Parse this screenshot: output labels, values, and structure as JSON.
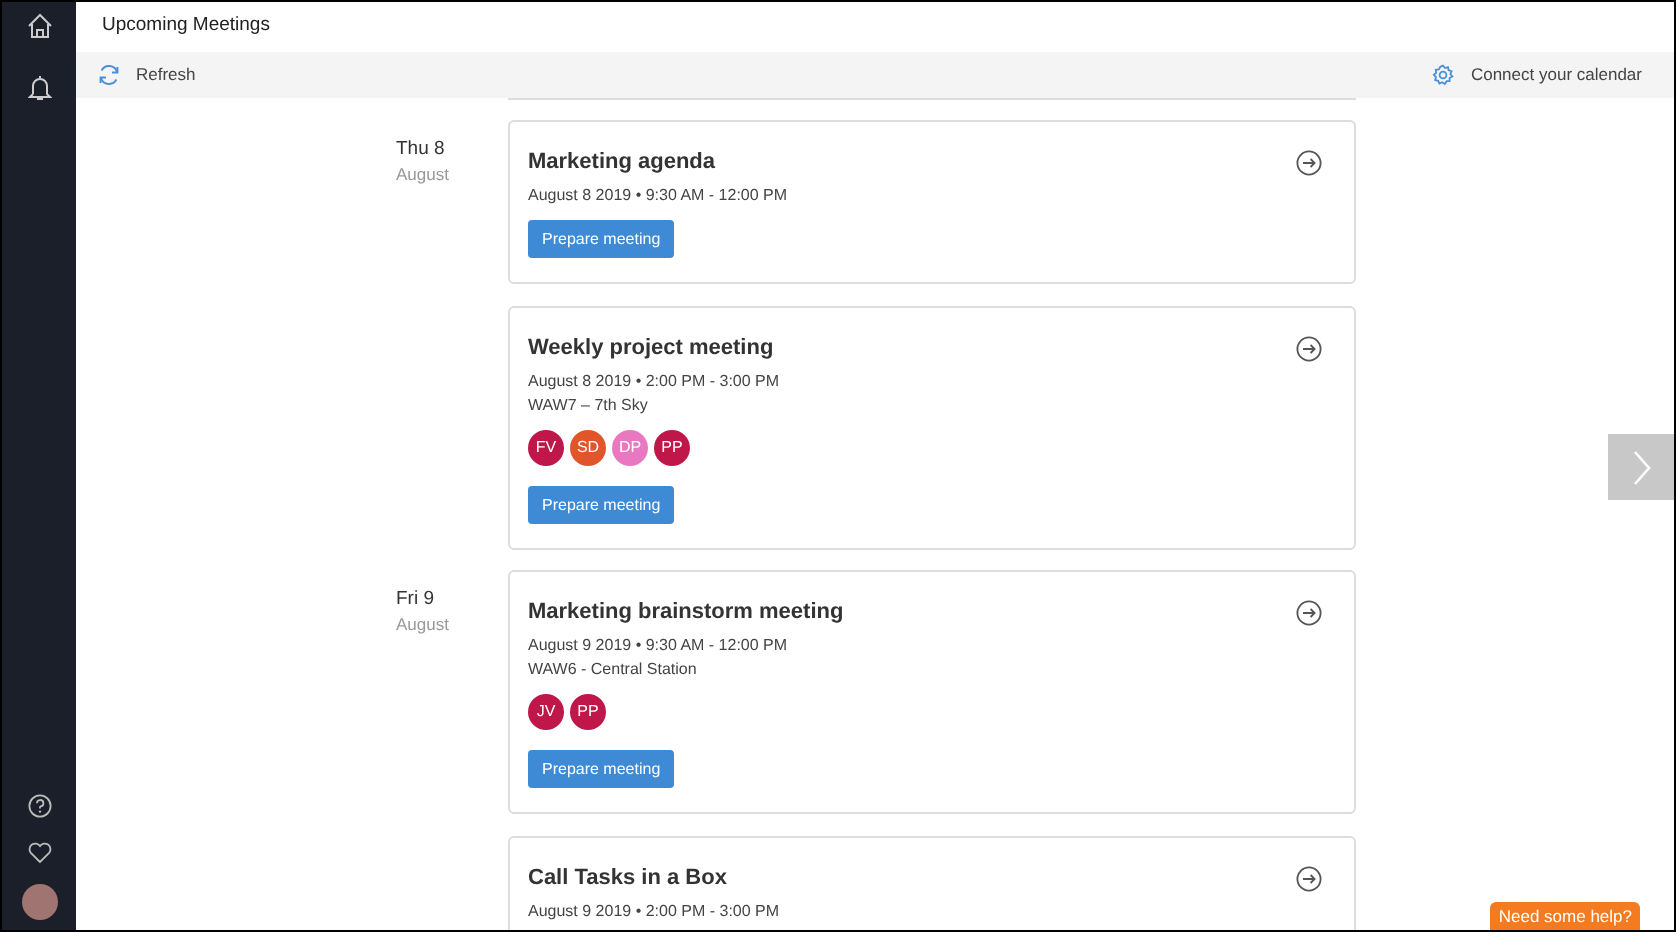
{
  "header": {
    "title": "Upcoming Meetings"
  },
  "toolbar": {
    "refresh": "Refresh",
    "connect": "Connect your calendar"
  },
  "days": [
    {
      "day": "Thu 8",
      "month": "August",
      "meetings": [
        {
          "title": "Marketing agenda",
          "when": "August 8 2019 • 9:30 AM - 12:00 PM",
          "button": "Prepare meeting"
        },
        {
          "title": "Weekly project meeting",
          "when": "August 8 2019 • 2:00 PM - 3:00 PM",
          "location": "WAW7 – 7th Sky",
          "attendees": [
            {
              "initials": "FV",
              "color": "#c0174a"
            },
            {
              "initials": "SD",
              "color": "#e0552a"
            },
            {
              "initials": "DP",
              "color": "#e879c0"
            },
            {
              "initials": "PP",
              "color": "#c0174a"
            }
          ],
          "button": "Prepare meeting"
        }
      ]
    },
    {
      "day": "Fri 9",
      "month": "August",
      "meetings": [
        {
          "title": "Marketing brainstorm meeting",
          "when": "August 9 2019 • 9:30 AM - 12:00 PM",
          "location": "WAW6 - Central Station",
          "attendees": [
            {
              "initials": "JV",
              "color": "#c0174a"
            },
            {
              "initials": "PP",
              "color": "#c0174a"
            }
          ],
          "button": "Prepare meeting"
        },
        {
          "title": "Call Tasks in a Box",
          "when": "August 9 2019 • 2:00 PM - 3:00 PM"
        }
      ]
    }
  ],
  "help": "Need some help?"
}
